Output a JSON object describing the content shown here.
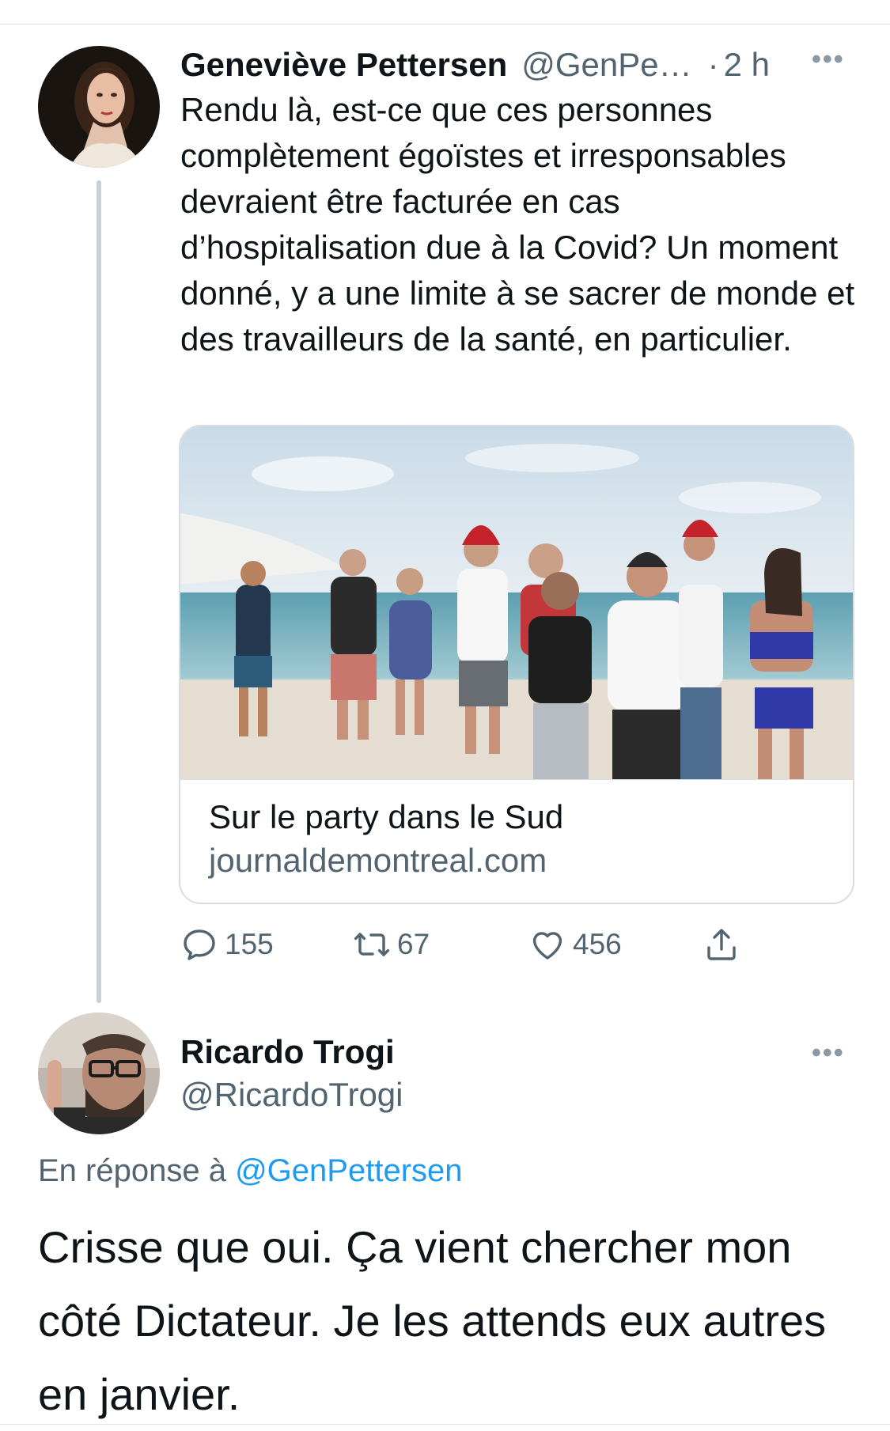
{
  "tweet": {
    "author_name": "Geneviève Pettersen",
    "author_handle": "@GenPe…",
    "separator": "·",
    "time": "2 h",
    "more": "•••",
    "text": "Rendu là, est-ce que ces personnes complètement égoïstes et irresponsables devraient être facturée en cas d’hospitalisation due à la Covid? Un moment donné, y a une limite à se sacrer de monde et des travailleurs de la santé, en particulier.",
    "card": {
      "title": "Sur le party dans le Sud",
      "domain": "journaldemontreal.com"
    },
    "actions": {
      "replies": "155",
      "retweets": "67",
      "likes": "456"
    }
  },
  "reply": {
    "author_name": "Ricardo Trogi",
    "author_handle": "@RicardoTrogi",
    "more": "•••",
    "replying_prefix": "En réponse à",
    "replying_to": "@GenPettersen",
    "text": "Crisse que oui. Ça vient chercher mon côté Dictateur. Je les attends eux autres en janvier."
  },
  "icons": {
    "reply": "comment-bubble-icon",
    "retweet": "retweet-icon",
    "like": "heart-icon",
    "share": "share-icon"
  },
  "colors": {
    "text": "#0f1419",
    "secondary": "#536471",
    "link": "#1d9bf0",
    "border": "#d7dde2"
  }
}
